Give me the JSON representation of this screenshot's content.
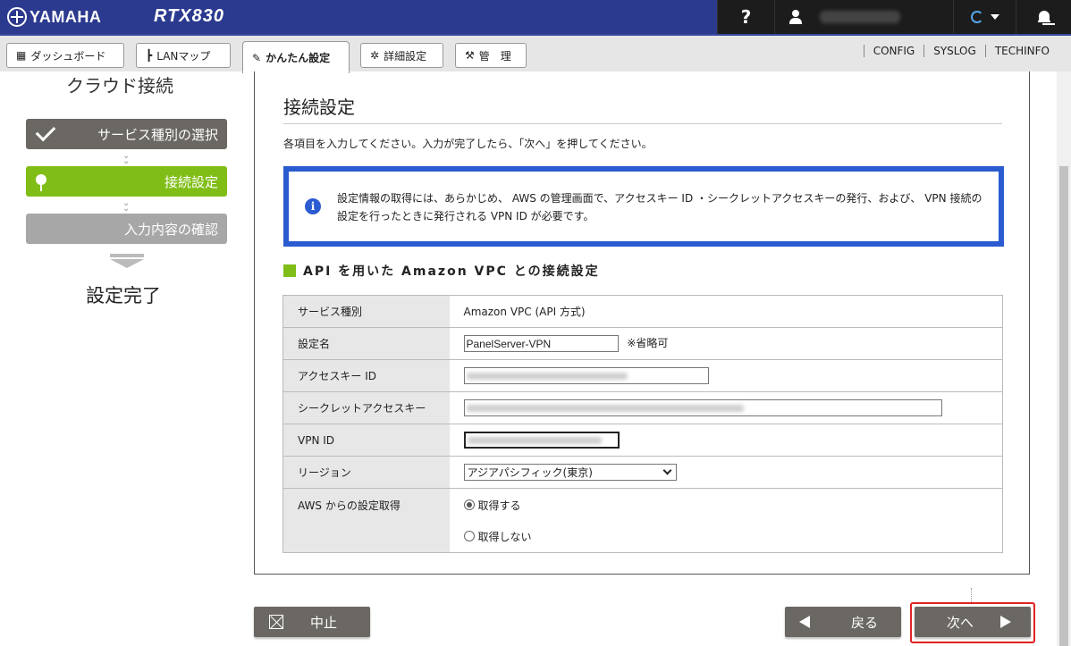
{
  "header": {
    "brand": "YAMAHA",
    "model": "RTX830",
    "help_label": "?"
  },
  "nav": {
    "tabs": [
      {
        "label": "ダッシュボード",
        "icon": "dashboard-icon"
      },
      {
        "label": "LANマップ",
        "icon": "lan-map-icon"
      },
      {
        "label": "かんたん設定",
        "icon": "wand-icon"
      },
      {
        "label": "詳細設定",
        "icon": "gear-icon"
      },
      {
        "label": "管　理",
        "icon": "wrench-icon"
      }
    ],
    "links": [
      "CONFIG",
      "SYSLOG",
      "TECHINFO"
    ]
  },
  "sidebar": {
    "title": "クラウド接続",
    "steps": [
      "サービス種別の選択",
      "接続設定",
      "入力内容の確認"
    ],
    "done": "設定完了"
  },
  "main": {
    "title": "接続設定",
    "instruction": "各項目を入力してください。入力が完了したら、「次へ」を押してください。",
    "info": "設定情報の取得には、あらかじめ、 AWS の管理画面で、アクセスキー ID ・シークレットアクセスキーの発行、および、 VPN 接続の設定を行ったときに発行される VPN ID が必要です。",
    "section_title": "API を用いた Amazon VPC との接続設定",
    "rows": {
      "service_label": "サービス種別",
      "service_value": "Amazon VPC (API 方式)",
      "name_label": "設定名",
      "name_value": "PanelServer-VPN",
      "name_note": "※省略可",
      "access_key_label": "アクセスキー ID",
      "secret_key_label": "シークレットアクセスキー",
      "vpn_id_label": "VPN ID",
      "region_label": "リージョン",
      "region_value": "アジアパシフィック(東京)",
      "fetch_label": "AWS からの設定取得",
      "fetch_yes": "取得する",
      "fetch_no": "取得しない"
    }
  },
  "buttons": {
    "cancel": "中止",
    "back": "戻る",
    "next": "次へ"
  },
  "colors": {
    "header_bg": "#2b3a8e",
    "active_step": "#80be17",
    "info_border": "#2b5bd0",
    "highlight": "#e02222"
  }
}
